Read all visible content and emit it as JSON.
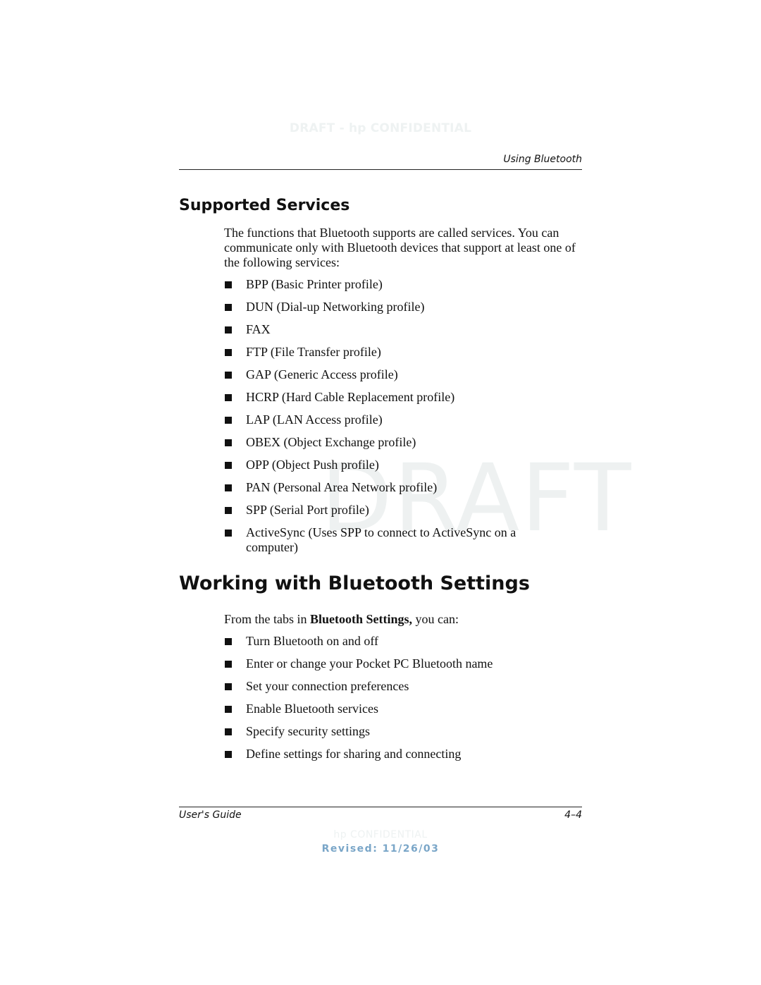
{
  "header": {
    "watermark": "DRAFT - hp CONFIDENTIAL",
    "running_head": "Using Bluetooth"
  },
  "section1": {
    "title": "Supported Services",
    "intro": "The functions that Bluetooth supports are called services. You can communicate only with Bluetooth devices that support at least one of the following services:",
    "items": [
      "BPP (Basic Printer profile)",
      "DUN (Dial-up Networking profile)",
      "FAX",
      "FTP (File Transfer profile)",
      "GAP (Generic Access profile)",
      "HCRP (Hard Cable Replacement profile)",
      "LAP (LAN Access profile)",
      "OBEX (Object Exchange profile)",
      "OPP (Object Push profile)",
      "PAN (Personal Area Network profile)",
      "SPP (Serial Port profile)",
      "ActiveSync (Uses SPP to connect to ActiveSync on a computer)"
    ]
  },
  "section2": {
    "title": "Working with Bluetooth Settings",
    "intro_prefix": "From the tabs in ",
    "intro_bold": "Bluetooth Settings,",
    "intro_suffix": " you can:",
    "items": [
      "Turn Bluetooth on and off",
      "Enter or change your Pocket PC Bluetooth name",
      "Set your connection preferences",
      "Enable Bluetooth services",
      "Specify security settings",
      "Define settings for sharing and connecting"
    ]
  },
  "watermark_center": "DRAFT",
  "footer": {
    "left": "User's Guide",
    "right": "4–4",
    "confidential": "hp CONFIDENTIAL",
    "revised": "Revised: 11/26/03"
  }
}
